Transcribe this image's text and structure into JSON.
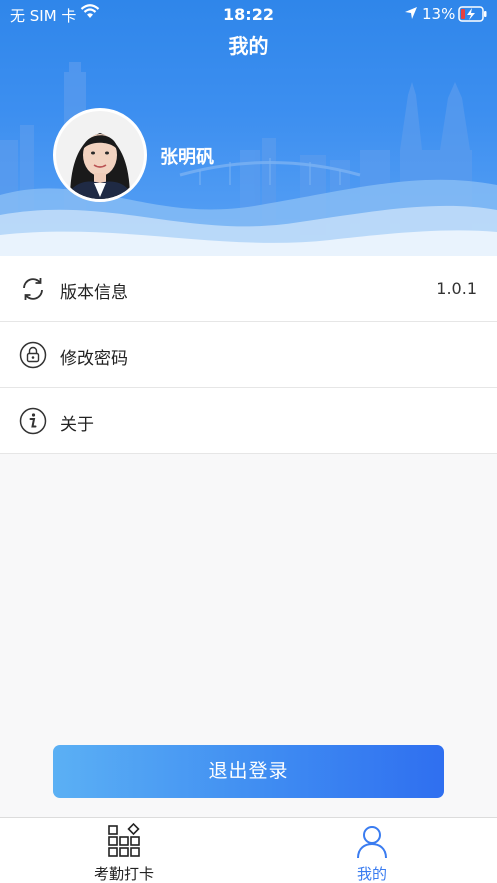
{
  "status_bar": {
    "carrier": "无 SIM 卡",
    "time": "18:22",
    "battery": "13%",
    "icons": [
      "wifi-icon",
      "location-arrow-icon",
      "battery-charging-icon"
    ]
  },
  "header": {
    "title": "我的"
  },
  "profile": {
    "name": "张明矾",
    "avatar": "user-photo"
  },
  "menu": {
    "items": [
      {
        "label": "版本信息",
        "value": "1.0.1",
        "icon": "refresh-icon"
      },
      {
        "label": "修改密码",
        "icon": "lock-icon"
      },
      {
        "label": "关于",
        "icon": "info-icon"
      }
    ]
  },
  "logout": {
    "label": "退出登录"
  },
  "tabbar": {
    "tabs": [
      {
        "label": "考勤打卡",
        "icon": "grid-apps-icon"
      },
      {
        "label": "我的",
        "icon": "person-icon"
      }
    ]
  },
  "colors": {
    "primary": "#2f86ea",
    "tab_active": "#3a7cf0",
    "tab_inactive": "#222222"
  }
}
